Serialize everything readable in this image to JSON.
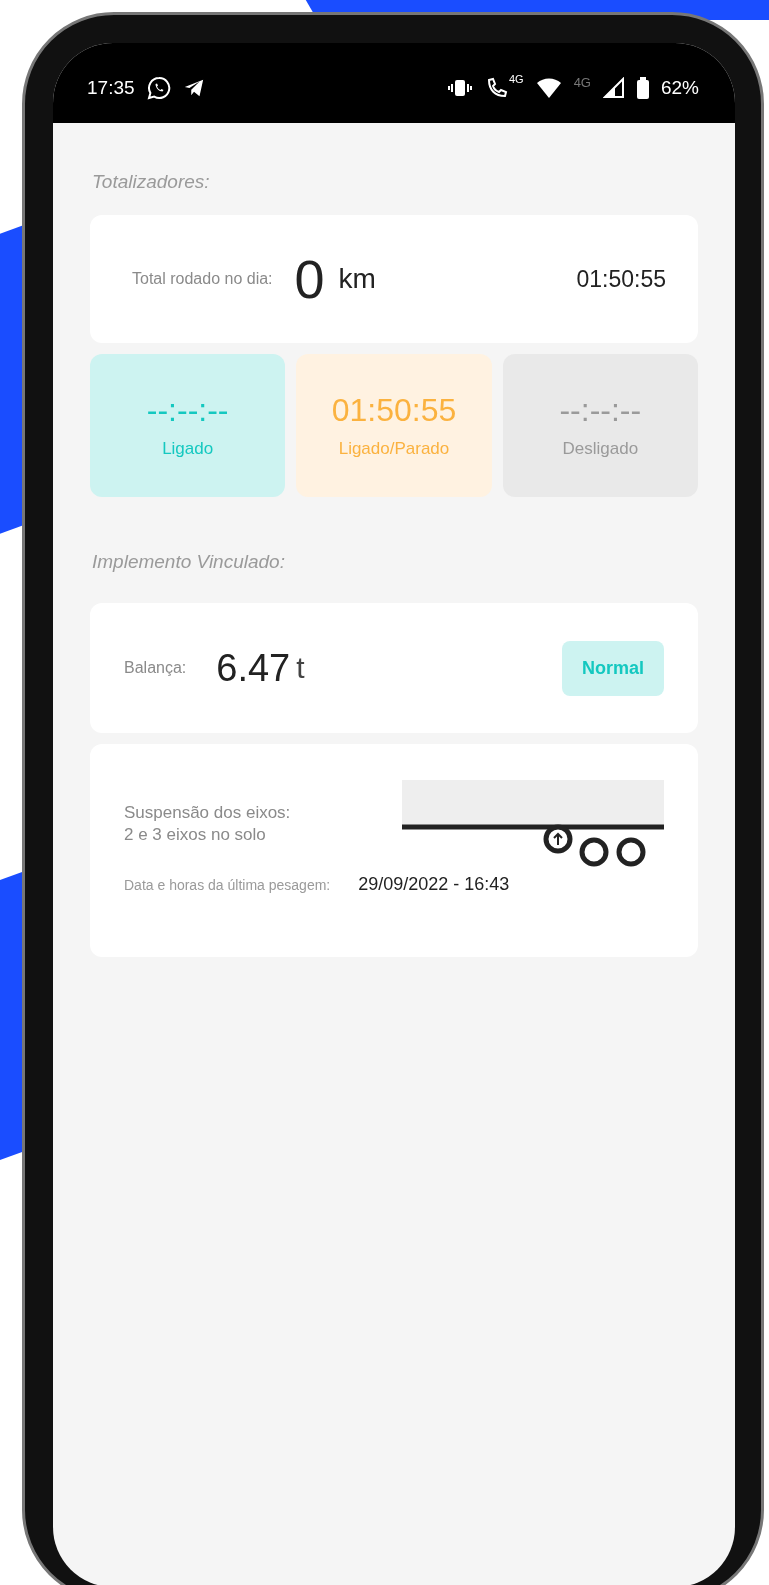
{
  "status_bar": {
    "time": "17:35",
    "call_network_label": "4G",
    "network_label": "4G",
    "battery": "62%"
  },
  "totals": {
    "heading": "Totalizadores:",
    "distance_label": "Total rodado no dia:",
    "distance_value": "0",
    "distance_unit": "km",
    "time": "01:50:55",
    "tiles": [
      {
        "kind": "on",
        "value": "--:--:--",
        "label": "Ligado"
      },
      {
        "kind": "idle",
        "value": "01:50:55",
        "label": "Ligado/Parado"
      },
      {
        "kind": "off",
        "value": "--:--:--",
        "label": "Desligado"
      }
    ]
  },
  "implement": {
    "heading": "Implemento Vinculado:",
    "scale_label": "Balança:",
    "weight": "6.47",
    "weight_unit": "t",
    "status": "Normal",
    "suspension_label": "Suspensão dos eixos:",
    "suspension_value": "2 e 3 eixos no solo",
    "last_weighing_label": "Data e horas da última pesagem:",
    "last_weighing_value": "29/09/2022 - 16:43"
  }
}
